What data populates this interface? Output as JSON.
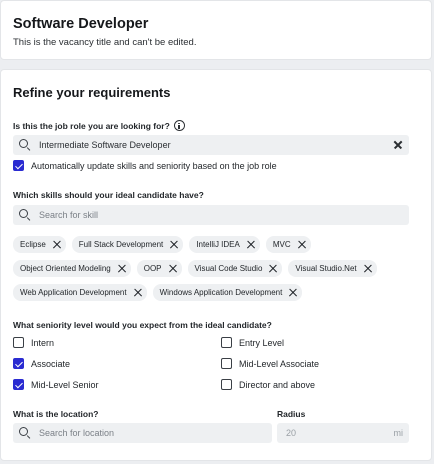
{
  "header": {
    "title": "Software Developer",
    "subtitle": "This is the vacancy title and can't be edited."
  },
  "requirements": {
    "section_title": "Refine your requirements",
    "job_role": {
      "question": "Is this the job role you are looking for?",
      "value": "Intermediate Software Developer",
      "icon": "info-icon"
    },
    "auto_update": {
      "label": "Automatically update skills and seniority based on the job role",
      "checked": true
    },
    "skills": {
      "question": "Which skills should your ideal candidate have?",
      "placeholder": "Search for skill",
      "chip_rows": [
        [
          "Eclipse",
          "Full Stack Development",
          "IntelliJ IDEA",
          "MVC"
        ],
        [
          "Object Oriented Modeling",
          "OOP",
          "Visual Code Studio",
          "Visual Studio.Net"
        ],
        [
          "Web Application Development",
          "Windows Application Development"
        ]
      ]
    },
    "seniority": {
      "question": "What seniority level would you expect from the ideal candidate?",
      "options": [
        {
          "label": "Intern",
          "checked": false
        },
        {
          "label": "Entry Level",
          "checked": false
        },
        {
          "label": "Associate",
          "checked": true
        },
        {
          "label": "Mid-Level Associate",
          "checked": false
        },
        {
          "label": "Mid-Level Senior",
          "checked": true
        },
        {
          "label": "Director and above",
          "checked": false
        }
      ]
    },
    "location": {
      "question": "What is the location?",
      "placeholder": "Search for location"
    },
    "radius": {
      "label": "Radius",
      "value": "20",
      "unit": "mi"
    }
  },
  "colors": {
    "accent": "#2a2bd1",
    "field_bg": "#eef0f2",
    "page_bg": "#eceef1"
  }
}
